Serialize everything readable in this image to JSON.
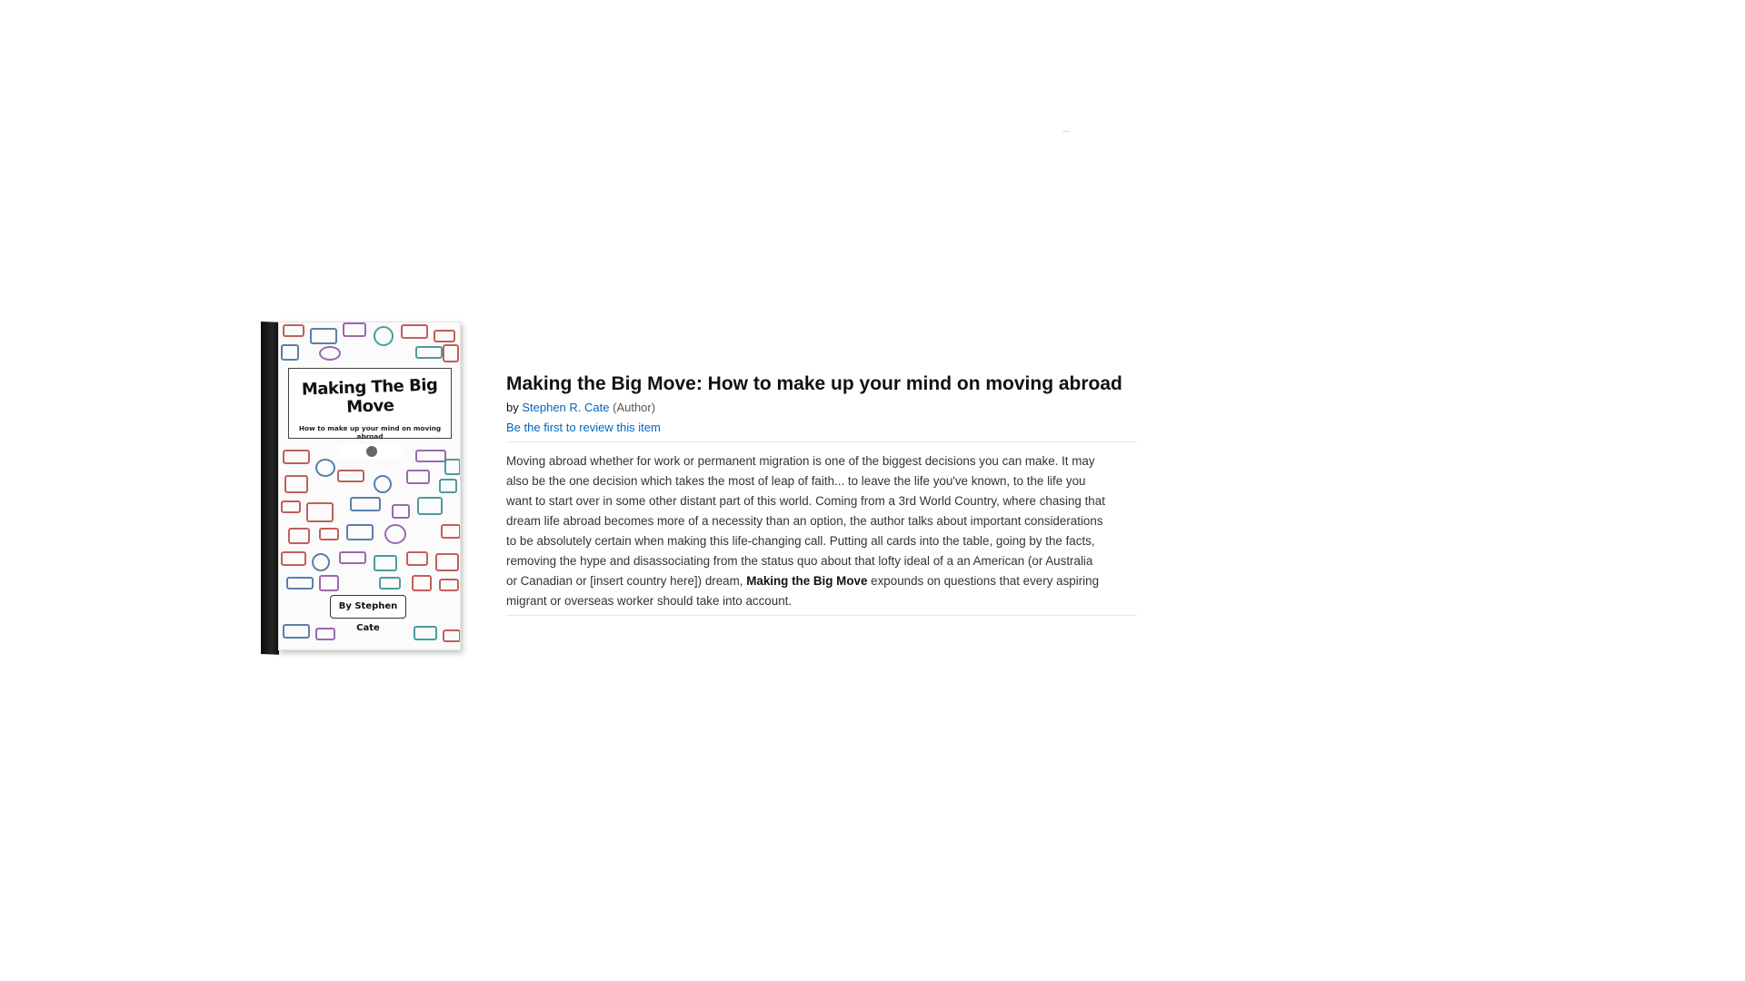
{
  "cover": {
    "title": "Making The Big Move",
    "subtitle": "How to make up your mind on moving abroad",
    "author_line": "By Stephen Cate"
  },
  "product": {
    "title": "Making the Big Move: How to make up your mind on moving abroad",
    "by_prefix": "by",
    "author": "Stephen R. Cate",
    "author_role": "(Author)",
    "review_link": "Be the first to review this item"
  },
  "description": {
    "part1": "Moving abroad whether for work or permanent migration is one of the biggest decisions you can make. It may also be the one decision which takes the most of leap of faith... to leave the life you've known, to the life you want to start over in some other distant part of this world. Coming from a 3rd World Country, where chasing that dream life abroad becomes more of a necessity than an option, the author talks about important considerations to be absolutely certain when making this life-changing call. Putting all cards into the table, going by the facts, removing the hype and disassociating from the status quo about that lofty ideal of a an American (or Australia or Canadian or [insert country here]) dream,",
    "bold": "Making the Big Move",
    "part2": "expounds on questions that every aspiring migrant or overseas worker should take into account."
  },
  "colors": {
    "link": "#0066c0",
    "stamp_red": "#b5443c",
    "stamp_blue": "#3c6a9e",
    "stamp_purple": "#8a4f9e",
    "stamp_teal": "#2f8a8a"
  }
}
